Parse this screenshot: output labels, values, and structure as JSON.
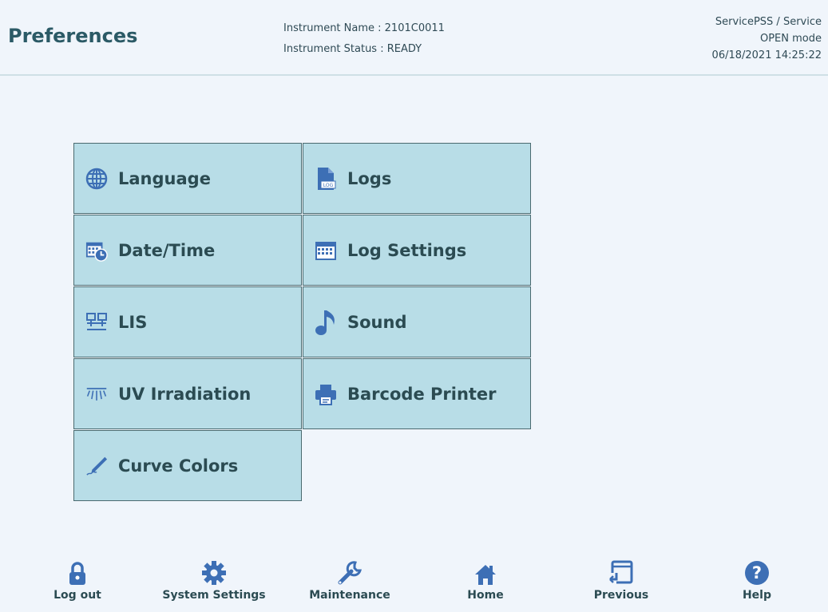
{
  "header": {
    "title": "Preferences",
    "instrument_name": "Instrument Name : 2101C0011",
    "instrument_status": "Instrument Status : READY",
    "user": "ServicePSS / Service",
    "mode": "OPEN mode",
    "datetime": "06/18/2021 14:25:22"
  },
  "tiles": [
    {
      "label": "Language",
      "icon": "globe-icon"
    },
    {
      "label": "Logs",
      "icon": "log-file-icon"
    },
    {
      "label": "Date/Time",
      "icon": "calendar-clock-icon"
    },
    {
      "label": "Log Settings",
      "icon": "calendar-grid-icon"
    },
    {
      "label": "LIS",
      "icon": "network-icon"
    },
    {
      "label": "Sound",
      "icon": "music-note-icon"
    },
    {
      "label": "UV Irradiation",
      "icon": "uv-lamp-icon"
    },
    {
      "label": "Barcode Printer",
      "icon": "printer-icon"
    },
    {
      "label": "Curve Colors",
      "icon": "pen-icon"
    }
  ],
  "nav": [
    {
      "label": "Log out",
      "icon": "lock-icon"
    },
    {
      "label": "System Settings",
      "icon": "gear-icon"
    },
    {
      "label": "Maintenance",
      "icon": "wrench-icon"
    },
    {
      "label": "Home",
      "icon": "home-icon"
    },
    {
      "label": "Previous",
      "icon": "previous-window-icon"
    },
    {
      "label": "Help",
      "icon": "help-icon"
    }
  ],
  "colors": {
    "tile_bg": "#b8dde7",
    "icon": "#3d6fb5",
    "title": "#2b5a66"
  }
}
